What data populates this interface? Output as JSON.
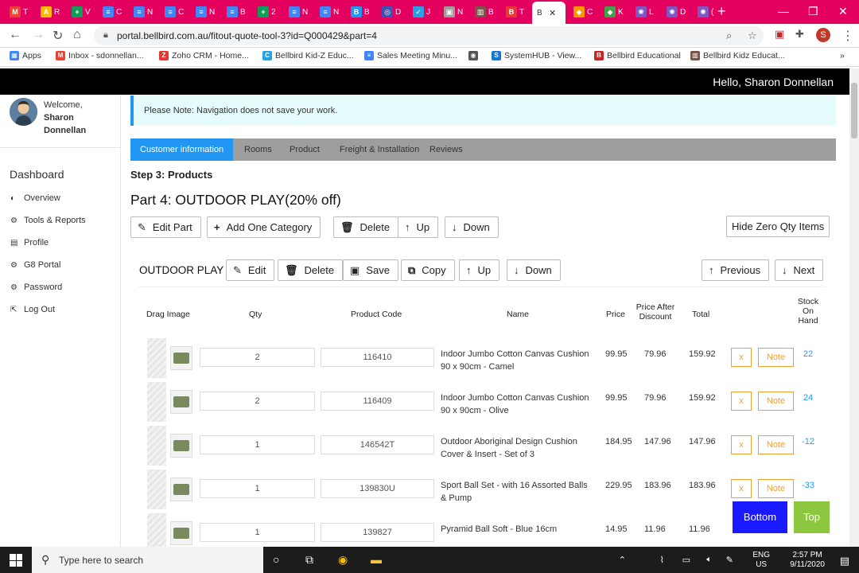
{
  "browser": {
    "tabs": [
      {
        "fav": "M",
        "color": "#ea4335",
        "label": "T"
      },
      {
        "fav": "A",
        "color": "#fbbc05",
        "label": "R"
      },
      {
        "fav": "+",
        "color": "#0f9d58",
        "label": "V"
      },
      {
        "fav": "≡",
        "color": "#4285f4",
        "label": "C"
      },
      {
        "fav": "≡",
        "color": "#4285f4",
        "label": "N"
      },
      {
        "fav": "≡",
        "color": "#4285f4",
        "label": "C"
      },
      {
        "fav": "≡",
        "color": "#4285f4",
        "label": "N"
      },
      {
        "fav": "≡",
        "color": "#4285f4",
        "label": "B"
      },
      {
        "fav": "+",
        "color": "#0f9d58",
        "label": "2"
      },
      {
        "fav": "≡",
        "color": "#4285f4",
        "label": "N"
      },
      {
        "fav": "≡",
        "color": "#4285f4",
        "label": "N"
      },
      {
        "fav": "B",
        "color": "#2196f3",
        "label": "B"
      },
      {
        "fav": "◎",
        "color": "#3f51b5",
        "label": "D"
      },
      {
        "fav": "✓",
        "color": "#26a3e0",
        "label": "J"
      },
      {
        "fav": "▣",
        "color": "#9e9e9e",
        "label": "N"
      },
      {
        "fav": "▥",
        "color": "#795548",
        "label": "B"
      },
      {
        "fav": "B",
        "color": "#e53935",
        "label": "T"
      },
      {
        "fav": "",
        "color": "#ffffff",
        "label": "B",
        "active": true
      },
      {
        "fav": "◆",
        "color": "#ff9800",
        "label": "C"
      },
      {
        "fav": "◆",
        "color": "#43a047",
        "label": "K"
      },
      {
        "fav": "✺",
        "color": "#7e57c2",
        "label": "L"
      },
      {
        "fav": "✺",
        "color": "#7e57c2",
        "label": "D"
      },
      {
        "fav": "✺",
        "color": "#7e57c2",
        "label": "("
      }
    ],
    "url": "portal.bellbird.com.au/fitout-quote-tool-3?id=Q000429&part=4",
    "profile_initial": "S",
    "bookmarks": [
      {
        "label": "Apps",
        "icon": "▦",
        "color": "#4285f4"
      },
      {
        "label": "Inbox - sdonnellan...",
        "icon": "M",
        "color": "#ea4335"
      },
      {
        "label": "Zoho CRM - Home...",
        "icon": "Z",
        "color": "#e53935"
      },
      {
        "label": "Bellbird Kid-Z Educ...",
        "icon": "C",
        "color": "#26a3e0"
      },
      {
        "label": "Sales Meeting Minu...",
        "icon": "≡",
        "color": "#4285f4"
      },
      {
        "label": "",
        "icon": "◉",
        "color": "#555555"
      },
      {
        "label": "SystemHUB - View...",
        "icon": "S",
        "color": "#1976d2"
      },
      {
        "label": "Bellbird Educational",
        "icon": "B",
        "color": "#c62828"
      },
      {
        "label": "Bellbird Kidz Educat...",
        "icon": "▥",
        "color": "#795548"
      }
    ]
  },
  "site": {
    "greeting": "Hello, Sharon Donnellan"
  },
  "sidebar": {
    "welcome": "Welcome,",
    "user_name": "Sharon Donnellan",
    "dashboard_title": "Dashboard",
    "items": [
      {
        "label": "Overview",
        "icon": "◐"
      },
      {
        "label": "Tools & Reports",
        "icon": "⚙"
      },
      {
        "label": "Profile",
        "icon": "▤"
      },
      {
        "label": "G8 Portal",
        "icon": "⚙"
      },
      {
        "label": "Password",
        "icon": "⚙"
      },
      {
        "label": "Log Out",
        "icon": "⇱"
      }
    ]
  },
  "main": {
    "notice": "Please Note: Navigation does not save your work.",
    "tabs": [
      "Customer information",
      "Rooms",
      "Product",
      "Freight & Installation",
      "Reviews"
    ],
    "step_title": "Step 3: Products",
    "part_title": "Part 4: OUTDOOR PLAY(20% off)",
    "part_buttons": {
      "edit_part": "Edit Part",
      "add_category": "Add One Category",
      "delete": "Delete",
      "up": "Up",
      "down": "Down",
      "hide_zero": "Hide Zero Qty Items"
    },
    "category": {
      "name": "OUTDOOR PLAY",
      "edit": "Edit",
      "delete": "Delete",
      "save": "Save",
      "copy": "Copy",
      "up": "Up",
      "down": "Down",
      "previous": "Previous",
      "next": "Next"
    },
    "columns": {
      "drag_image": "Drag Image",
      "qty": "Qty",
      "product_code": "Product Code",
      "name": "Name",
      "price": "Price",
      "price_after_discount": "Price After Discount",
      "total": "Total",
      "stock_on_hand": "Stock On Hand"
    },
    "rows": [
      {
        "qty": "2",
        "code": "116410",
        "name": "Indoor Jumbo Cotton Canvas Cushion 90 x 90cm - Camel",
        "price": "99.95",
        "disc": "79.96",
        "total": "159.92",
        "stock": "22"
      },
      {
        "qty": "2",
        "code": "116409",
        "name": "Indoor Jumbo Cotton Canvas Cushion 90 x 90cm - Olive",
        "price": "99.95",
        "disc": "79.96",
        "total": "159.92",
        "stock": "24"
      },
      {
        "qty": "1",
        "code": "146542T",
        "name": "Outdoor Aboriginal Design Cushion Cover & Insert - Set of 3",
        "price": "184.95",
        "disc": "147.96",
        "total": "147.96",
        "stock": "-12"
      },
      {
        "qty": "1",
        "code": "139830U",
        "name": "Sport Ball Set - with 16 Assorted Balls & Pump",
        "price": "229.95",
        "disc": "183.96",
        "total": "183.96",
        "stock": "-33"
      },
      {
        "qty": "1",
        "code": "139827",
        "name": "Pyramid Ball Soft - Blue 16cm",
        "price": "14.95",
        "disc": "11.96",
        "total": "11.96",
        "stock": ""
      }
    ],
    "row_x": "x",
    "row_note": "Note",
    "bottom": "Bottom",
    "top": "Top"
  },
  "taskbar": {
    "search_placeholder": "Type here to search",
    "lang": "ENG",
    "region": "US",
    "time": "2:57 PM",
    "date": "9/11/2020"
  }
}
